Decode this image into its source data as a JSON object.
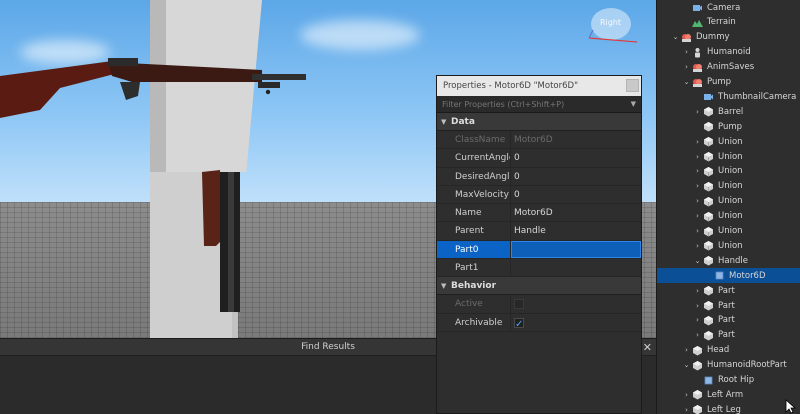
{
  "viewport": {
    "nav_cube_label": "Right"
  },
  "find_results": {
    "title": "Find Results",
    "close_label": "✕"
  },
  "properties": {
    "title": "Properties - Motor6D \"Motor6D\"",
    "filter_placeholder": "Filter Properties (Ctrl+Shift+P)",
    "sections": [
      {
        "name": "Data",
        "rows": [
          {
            "name": "ClassName",
            "value": "Motor6D",
            "disabled": true
          },
          {
            "name": "CurrentAngle",
            "value": "0"
          },
          {
            "name": "DesiredAngle",
            "value": "0"
          },
          {
            "name": "MaxVelocity",
            "value": "0"
          },
          {
            "name": "Name",
            "value": "Motor6D"
          },
          {
            "name": "Parent",
            "value": "Handle"
          },
          {
            "name": "Part0",
            "value": "",
            "selected": true
          },
          {
            "name": "Part1",
            "value": ""
          }
        ]
      },
      {
        "name": "Behavior",
        "rows": [
          {
            "name": "Active",
            "checked": false,
            "disabled": true
          },
          {
            "name": "Archivable",
            "checked": true
          }
        ]
      }
    ]
  },
  "explorer": {
    "items": [
      {
        "label": "Camera",
        "indent": 2,
        "arrow": "",
        "icon": "camera-icon"
      },
      {
        "label": "Terrain",
        "indent": 2,
        "arrow": "",
        "icon": "terrain-icon"
      },
      {
        "label": "Dummy",
        "indent": 1,
        "arrow": "down",
        "icon": "model-icon"
      },
      {
        "label": "Humanoid",
        "indent": 2,
        "arrow": "right",
        "icon": "humanoid-icon"
      },
      {
        "label": "AnimSaves",
        "indent": 2,
        "arrow": "right",
        "icon": "model-icon"
      },
      {
        "label": "Pump",
        "indent": 2,
        "arrow": "down",
        "icon": "model-icon"
      },
      {
        "label": "ThumbnailCamera",
        "indent": 3,
        "arrow": "",
        "icon": "camera-icon"
      },
      {
        "label": "Barrel",
        "indent": 3,
        "arrow": "right",
        "icon": "part-icon"
      },
      {
        "label": "Pump",
        "indent": 3,
        "arrow": "",
        "icon": "part-icon"
      },
      {
        "label": "Union",
        "indent": 3,
        "arrow": "right",
        "icon": "union-icon"
      },
      {
        "label": "Union",
        "indent": 3,
        "arrow": "right",
        "icon": "union-icon"
      },
      {
        "label": "Union",
        "indent": 3,
        "arrow": "right",
        "icon": "union-icon"
      },
      {
        "label": "Union",
        "indent": 3,
        "arrow": "right",
        "icon": "union-icon"
      },
      {
        "label": "Union",
        "indent": 3,
        "arrow": "right",
        "icon": "union-icon"
      },
      {
        "label": "Union",
        "indent": 3,
        "arrow": "right",
        "icon": "union-icon"
      },
      {
        "label": "Union",
        "indent": 3,
        "arrow": "right",
        "icon": "union-icon"
      },
      {
        "label": "Union",
        "indent": 3,
        "arrow": "right",
        "icon": "union-icon"
      },
      {
        "label": "Handle",
        "indent": 3,
        "arrow": "down",
        "icon": "part-icon"
      },
      {
        "label": "Motor6D",
        "indent": 4,
        "arrow": "",
        "icon": "motor6d-icon",
        "selected": true
      },
      {
        "label": "Part",
        "indent": 3,
        "arrow": "right",
        "icon": "part-icon"
      },
      {
        "label": "Part",
        "indent": 3,
        "arrow": "right",
        "icon": "part-icon"
      },
      {
        "label": "Part",
        "indent": 3,
        "arrow": "right",
        "icon": "part-icon"
      },
      {
        "label": "Part",
        "indent": 3,
        "arrow": "right",
        "icon": "part-icon"
      },
      {
        "label": "Head",
        "indent": 2,
        "arrow": "right",
        "icon": "part-icon"
      },
      {
        "label": "HumanoidRootPart",
        "indent": 2,
        "arrow": "down",
        "icon": "part-icon"
      },
      {
        "label": "Root Hip",
        "indent": 3,
        "arrow": "",
        "icon": "motor6d-icon"
      },
      {
        "label": "Left Arm",
        "indent": 2,
        "arrow": "right",
        "icon": "part-icon"
      },
      {
        "label": "Left Leg",
        "indent": 2,
        "arrow": "right",
        "icon": "part-icon"
      }
    ]
  }
}
